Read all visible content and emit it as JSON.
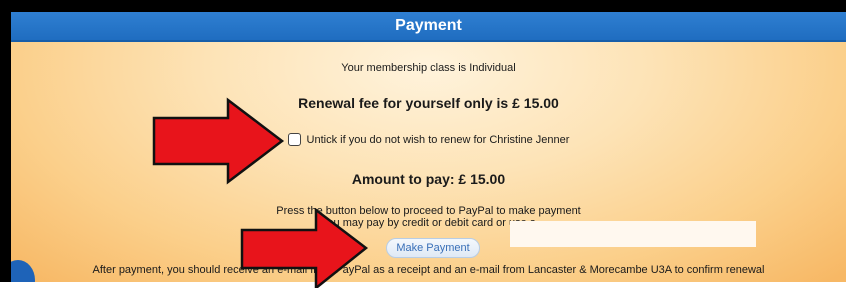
{
  "header": {
    "title": "Payment"
  },
  "membership": {
    "class_text": "Your membership class is Individual"
  },
  "renewal": {
    "fee_text": "Renewal fee for yourself only is £ 15.00"
  },
  "untick": {
    "label": "Untick if you do not wish to renew for Christine Jenner",
    "checked": false
  },
  "amount": {
    "text": "Amount to pay: £ 15.00"
  },
  "instructions": {
    "line1": "Press the button below to proceed to PayPal to make payment",
    "line2": "You may pay by credit or debit card or use a"
  },
  "payment_button": {
    "label": "Make Payment"
  },
  "after_payment": {
    "text": "After payment, you should receive an e-mail from PayPal as a receipt and an e-mail from Lancaster & Morecambe U3A to confirm renewal"
  },
  "colors": {
    "header_bg": "#1f6dc0",
    "panel_bg": "#fbcf8a",
    "arrow": "#e8141b",
    "button_text": "#3a70b8"
  },
  "icons": [
    "red-arrow-icon",
    "red-arrow-icon"
  ]
}
